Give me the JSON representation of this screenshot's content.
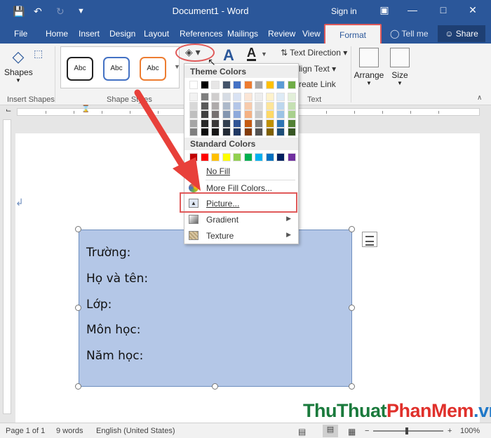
{
  "window": {
    "title": "Document1 - Word",
    "signin": "Sign in"
  },
  "tabs": [
    {
      "label": "File"
    },
    {
      "label": "Home"
    },
    {
      "label": "Insert"
    },
    {
      "label": "Design"
    },
    {
      "label": "Layout"
    },
    {
      "label": "References"
    },
    {
      "label": "Mailings"
    },
    {
      "label": "Review"
    },
    {
      "label": "View"
    }
  ],
  "active_tab": "Format",
  "tellme": "Tell me",
  "share": "Share",
  "ribbon": {
    "shapes": "Shapes",
    "insert_shapes_label": "Insert Shapes",
    "shape_styles_label": "Shape Styles",
    "style_samples": [
      "Abc",
      "Abc",
      "Abc"
    ],
    "text_direction": "Text Direction",
    "align_text": "lign Text",
    "create_link": "reate Link",
    "text_label": "Text",
    "arrange": "Arrange",
    "size": "Size"
  },
  "menu": {
    "theme_colors_label": "Theme Colors",
    "standard_colors_label": "Standard Colors",
    "no_fill": "No Fill",
    "more_fill_colors": "More Fill Colors...",
    "picture": "Picture...",
    "gradient": "Gradient",
    "texture": "Texture",
    "theme_top_row": [
      "#ffffff",
      "#000000",
      "#e7e6e6",
      "#44546a",
      "#4472c4",
      "#ed7d31",
      "#a5a5a5",
      "#ffc000",
      "#5b9bd5",
      "#70ad47"
    ],
    "theme_shades": [
      [
        "#f2f2f2",
        "#7f7f7f",
        "#d0cece",
        "#d6dce4",
        "#d9e2f3",
        "#fbe5d5",
        "#ededed",
        "#fff2cc",
        "#deebf6",
        "#e2efd9"
      ],
      [
        "#d8d8d8",
        "#595959",
        "#aeabab",
        "#adb9ca",
        "#b4c6e7",
        "#f7cbac",
        "#dbdbdb",
        "#fee599",
        "#bdd7ee",
        "#c5e0b3"
      ],
      [
        "#bfbfbf",
        "#3f3f3f",
        "#757070",
        "#8496b0",
        "#8eaadb",
        "#f4b183",
        "#c9c9c9",
        "#ffd965",
        "#9cc3e5",
        "#a8d08d"
      ],
      [
        "#a5a5a5",
        "#262626",
        "#3a3838",
        "#323f4f",
        "#2f5496",
        "#c55a11",
        "#7b7b7b",
        "#bf9000",
        "#2e75b5",
        "#538135"
      ],
      [
        "#7f7f7f",
        "#0c0c0c",
        "#171616",
        "#222a35",
        "#1f3864",
        "#833c0b",
        "#525252",
        "#7f6000",
        "#1e4e79",
        "#375623"
      ]
    ],
    "standard": [
      "#c00000",
      "#ff0000",
      "#ffc000",
      "#ffff00",
      "#92d050",
      "#00b050",
      "#00b0f0",
      "#0070c0",
      "#002060",
      "#7030a0"
    ]
  },
  "textbox_lines": [
    "Trường:",
    "Họ và tên:",
    "Lớp:",
    "Môn học:",
    "Năm học:"
  ],
  "status": {
    "page": "Page 1 of 1",
    "words": "9 words",
    "language": "English (United States)",
    "zoom": "100%"
  },
  "watermark": {
    "part1": "ThuThuat",
    "part2": "PhanMem",
    "part3": ".vn"
  },
  "colors": {
    "accent": "#2b579a",
    "highlight": "#e05a5a",
    "shape_fill": "#b4c7e7"
  }
}
